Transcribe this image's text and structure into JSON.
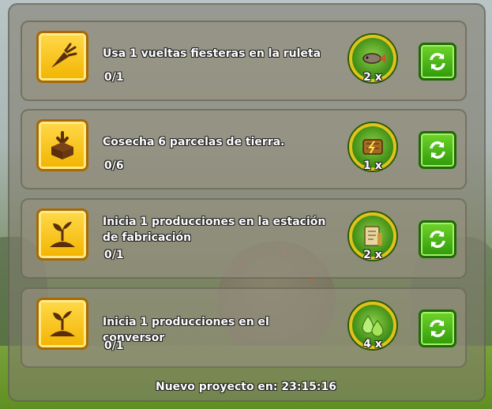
{
  "tasks": [
    {
      "title": "Usa 1 vueltas fiesteras en la ruleta",
      "progress": "0/1",
      "reward_qty": "2 x",
      "task_icon": "carrot-icon",
      "reward_icon": "fish-icon"
    },
    {
      "title": "Cosecha 6 parcelas de tierra.",
      "progress": "0/6",
      "reward_qty": "1 x",
      "task_icon": "harvest-box-icon",
      "reward_icon": "wood-plank-icon"
    },
    {
      "title": "Inicia 1 producciones en la estación de fabricación",
      "progress": "0/1",
      "reward_qty": "2 x",
      "task_icon": "sprout-icon",
      "reward_icon": "paper-roll-icon"
    },
    {
      "title": "Inicia 1 producciones en el conversor",
      "progress": "0/1",
      "reward_qty": "4 x",
      "task_icon": "sprout-icon",
      "reward_icon": "water-drops-icon"
    }
  ],
  "footer": {
    "text": "Nuevo proyecto en: 23:15:16"
  },
  "colors": {
    "accent": "#f2b400",
    "refresh": "#2f9a0a",
    "reward_ring": "#e0c21a"
  }
}
